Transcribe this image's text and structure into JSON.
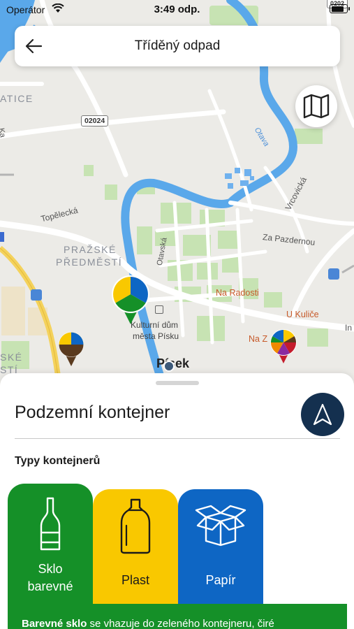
{
  "status_bar": {
    "carrier": "Operátor",
    "time": "3:49 odp.",
    "battery_level": 0.85
  },
  "header": {
    "title": "Tříděný odpad",
    "back_icon": "arrow-left-icon"
  },
  "map": {
    "map_toggle_icon": "map-icon",
    "labels": {
      "atice": "ATICE",
      "road_02024": "02024",
      "topelecka": "Topělecká",
      "prazske_predmesti_1": "PRAŽSKÉ",
      "prazske_predmesti_2": "PŘEDMĚSTÍ",
      "otavska": "Otavská",
      "za_pazdernou": "Za Pazdernou",
      "vrcovicka": "Vrcovická",
      "otava": "Otava",
      "na_radosti": "Na Radosti",
      "u_kulice": "U Kuliče",
      "na_z": "Na Z",
      "kulturni_dum_1": "Kulturní dům",
      "kulturni_dum_2": "města Písku",
      "pisek": "Písek",
      "ske": "SKÉ",
      "sti": "STÍ",
      "ka": "Ka",
      "in": "In",
      "road_0202": "0202"
    }
  },
  "sheet": {
    "title": "Podzemní kontejner",
    "navigate_icon": "navigation-arrow-icon",
    "section_title": "Typy kontejnerů",
    "cards": [
      {
        "label_line1": "Sklo",
        "label_line2": "barevné",
        "icon": "bottle-icon",
        "color": "#159028"
      },
      {
        "label": "Plast",
        "icon": "plastic-bottle-icon",
        "color": "#f9c800"
      },
      {
        "label": "Papír",
        "icon": "paper-box-icon",
        "color": "#0e66c4"
      }
    ],
    "info": {
      "bold": "Barevné sklo",
      "text": " se vhazuje do zeleného kontejneru, čiré"
    }
  },
  "colors": {
    "glass_green": "#159028",
    "plastic_yellow": "#f9c800",
    "paper_blue": "#0e66c4",
    "navy": "#14304f",
    "river": "#4fa3e6",
    "park": "#b7dfa0"
  }
}
